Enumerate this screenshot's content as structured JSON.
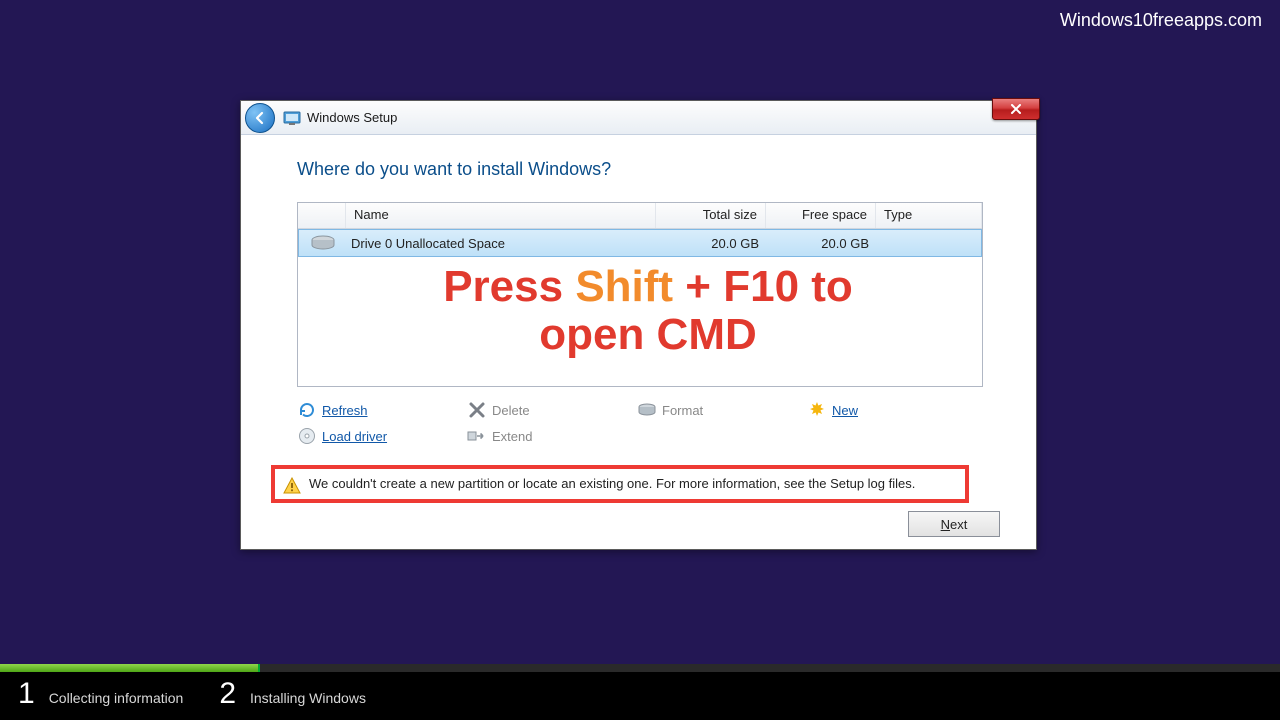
{
  "watermark": "Windows10freeapps.com",
  "window": {
    "title": "Windows Setup",
    "heading": "Where do you want to install Windows?",
    "columns": {
      "name": "Name",
      "total": "Total size",
      "free": "Free space",
      "type": "Type"
    },
    "row": {
      "name": "Drive 0 Unallocated Space",
      "total": "20.0 GB",
      "free": "20.0 GB",
      "type": ""
    },
    "overlay": {
      "part1": "Press ",
      "part2": "Shift",
      "part3": " + F10 to open CMD"
    },
    "actions": {
      "refresh": "Refresh",
      "delete": "Delete",
      "format": "Format",
      "new": "New",
      "load_driver": "Load driver",
      "extend": "Extend"
    },
    "warning": "We couldn't create a new partition or locate an existing one. For more information, see the Setup log files.",
    "next": "Next"
  },
  "steps": {
    "s1_num": "1",
    "s1_label": "Collecting information",
    "s2_num": "2",
    "s2_label": "Installing Windows"
  }
}
